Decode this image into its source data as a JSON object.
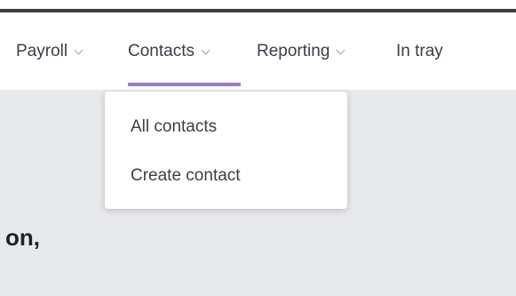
{
  "nav": {
    "items": [
      {
        "label": "Payroll",
        "has_dropdown": true,
        "active": false
      },
      {
        "label": "Contacts",
        "has_dropdown": true,
        "active": true
      },
      {
        "label": "Reporting",
        "has_dropdown": true,
        "active": false
      },
      {
        "label": "In tray",
        "has_dropdown": false,
        "active": false
      }
    ]
  },
  "dropdown": {
    "items": [
      {
        "label": "All contacts"
      },
      {
        "label": "Create contact"
      }
    ]
  },
  "greeting": {
    "text": "on,"
  },
  "colors": {
    "accent": "#9b78d0",
    "background": "#e7e9ec",
    "text": "#3a4049"
  }
}
